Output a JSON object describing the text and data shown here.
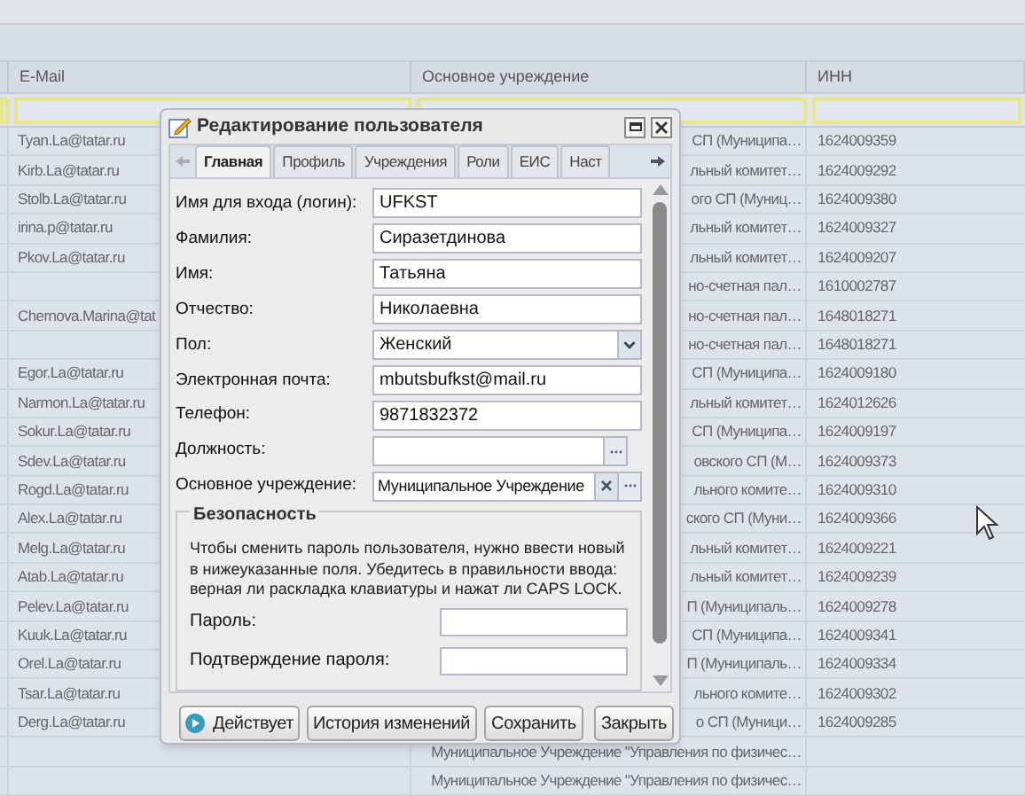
{
  "grid": {
    "columns": [
      {
        "label": "E-Mail"
      },
      {
        "label": "Основное учреждение"
      },
      {
        "label": "ИНН"
      }
    ],
    "rows": [
      {
        "email": "Tyan.La@tatar.ru",
        "institution": "СП (Муниципа…",
        "inn": "1624009359"
      },
      {
        "email": "Kirb.La@tatar.ru",
        "institution": "льный комитет…",
        "inn": "1624009292"
      },
      {
        "email": "Stolb.La@tatar.ru",
        "institution": "ого СП (Муниц…",
        "inn": "1624009380"
      },
      {
        "email": "irina.p@tatar.ru",
        "institution": "льный комитет…",
        "inn": "1624009327"
      },
      {
        "email": "Pkov.La@tatar.ru",
        "institution": "льный комитет…",
        "inn": "1624009207"
      },
      {
        "institution": "но-счетная пал…",
        "inn": "1610002787"
      },
      {
        "email": "Chernova.Marina@tat",
        "institution": "но-счетная пал…",
        "inn": "1648018271"
      },
      {
        "institution": "но-счетная пал…",
        "inn": "1648018271"
      },
      {
        "email": "Egor.La@tatar.ru",
        "institution": "СП (Муниципа…",
        "inn": "1624009180"
      },
      {
        "email": "Narmon.La@tatar.ru",
        "institution": "льный комитет…",
        "inn": "1624012626"
      },
      {
        "email": "Sokur.La@tatar.ru",
        "institution": "СП (Муниципа…",
        "inn": "1624009197"
      },
      {
        "email": "Sdev.La@tatar.ru",
        "institution": "овского СП (М…",
        "inn": "1624009373"
      },
      {
        "email": "Rogd.La@tatar.ru",
        "institution": "льного комите…",
        "inn": "1624009310"
      },
      {
        "email": "Alex.La@tatar.ru",
        "institution": "ского СП (Муни…",
        "inn": "1624009366"
      },
      {
        "email": "Melg.La@tatar.ru",
        "institution": "льный комитет…",
        "inn": "1624009221"
      },
      {
        "email": "Atab.La@tatar.ru",
        "institution": "льный комитет…",
        "inn": "1624009239"
      },
      {
        "email": "Pelev.La@tatar.ru",
        "institution": "П (Муниципаль…",
        "inn": "1624009278"
      },
      {
        "email": "Kuuk.La@tatar.ru",
        "institution": "СП (Муниципа…",
        "inn": "1624009341"
      },
      {
        "email": "Orel.La@tatar.ru",
        "institution": "П (Муниципаль…",
        "inn": "1624009334"
      },
      {
        "email": "Tsar.La@tatar.ru",
        "institution": "льного комите…",
        "inn": "1624009302"
      },
      {
        "email": "Derg.La@tatar.ru",
        "institution": "о СП (Муници…",
        "inn": "1624009285"
      },
      {
        "institution": "Муниципальное Учреждение \"Управления по физичес…"
      },
      {
        "institution": "Муниципальное Учреждение \"Управления по физичес…"
      }
    ]
  },
  "dialog": {
    "title": "Редактирование пользователя",
    "tabs": [
      {
        "label": "Главная",
        "selected": true
      },
      {
        "label": "Профиль",
        "selected": false
      },
      {
        "label": "Учреждения",
        "selected": false
      },
      {
        "label": "Роли",
        "selected": false
      },
      {
        "label": "ЕИС",
        "selected": false
      },
      {
        "label": "Наст",
        "selected": false
      }
    ],
    "fields": [
      {
        "kind": "text",
        "label": "Имя для входа (логин):",
        "value": "UFKST"
      },
      {
        "kind": "text",
        "label": "Фамилия:",
        "value": "Сиразетдинова"
      },
      {
        "kind": "text",
        "label": "Имя:",
        "value": "Татьяна"
      },
      {
        "kind": "text",
        "label": "Отчество:",
        "value": "Николаевна"
      },
      {
        "kind": "select",
        "label": "Пол:",
        "value": "Женский"
      },
      {
        "kind": "text",
        "label": "Электронная почта:",
        "value": "mbutsbufkst@mail.ru"
      },
      {
        "kind": "text",
        "label": "Телефон:",
        "value": "9871832372"
      },
      {
        "kind": "lookup",
        "label": "Должность:"
      },
      {
        "kind": "lookup_clear",
        "label": "Основное учреждение:",
        "value": "Муниципальное Учреждение"
      }
    ],
    "security": {
      "title": "Безопасность",
      "note": "Чтобы сменить пароль пользователя, нужно ввести новый в нижеуказанные поля. Убедитесь в правильности ввода: верная ли раскладка клавиатуры и нажат ли CAPS LOCK.",
      "fields": [
        {
          "label": "Пароль:"
        },
        {
          "label": "Подтверждение пароля:"
        }
      ]
    },
    "buttons": [
      {
        "kind": "status",
        "label": "Действует"
      },
      {
        "kind": "plain",
        "label": "История изменений"
      },
      {
        "kind": "spacer_plain",
        "label": "Сохранить"
      },
      {
        "kind": "plain",
        "label": "Закрыть"
      }
    ]
  }
}
